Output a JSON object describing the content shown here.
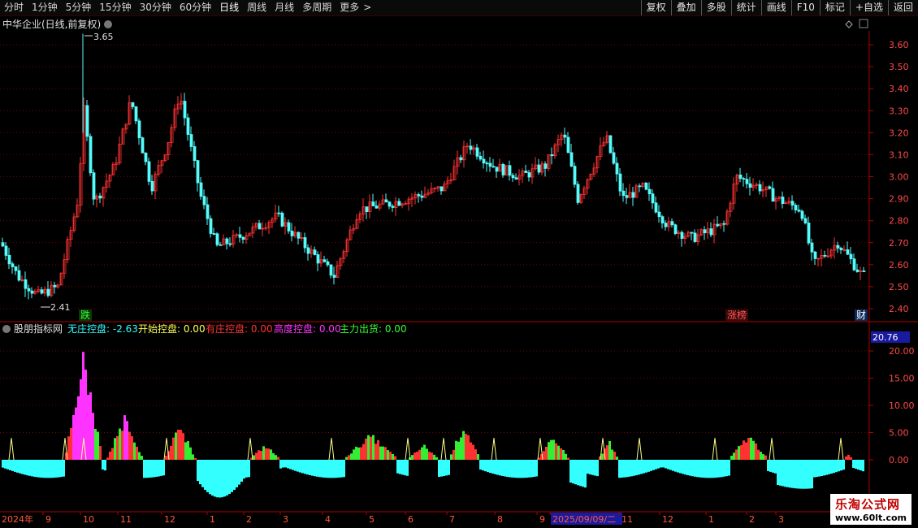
{
  "toolbar": {
    "periods": [
      "分时",
      "1分钟",
      "5分钟",
      "15分钟",
      "30分钟",
      "60分钟",
      "日线",
      "周线",
      "月线",
      "多周期",
      "更多"
    ],
    "more_arrow": ">",
    "active_period": "日线",
    "actions": [
      "复权",
      "叠加",
      "多股",
      "统计",
      "画线",
      "F10",
      "标记",
      "+自选",
      "返回"
    ]
  },
  "main_panel": {
    "title": "中华企业(日线,前复权)",
    "high_label": "3.65",
    "low_label": "2.41",
    "y_ticks": [
      "3.60",
      "3.50",
      "3.40",
      "3.30",
      "3.20",
      "3.10",
      "3.00",
      "2.90",
      "2.80",
      "2.70",
      "2.60",
      "2.50",
      "2.40"
    ],
    "markers": [
      "跌",
      "涨榜",
      "财"
    ]
  },
  "indicator_panel": {
    "name": "股朋指标网",
    "legend": [
      {
        "label": "无庄控盘:",
        "value": "-2.63",
        "color": "#33ffff"
      },
      {
        "label": "开始控盘:",
        "value": "0.00",
        "color": "#ffff55"
      },
      {
        "label": "有庄控盘:",
        "value": "0.00",
        "color": "#ff3333"
      },
      {
        "label": "高度控盘:",
        "value": "0.00",
        "color": "#ff33ff"
      },
      {
        "label": "主力出货:",
        "value": "0.00",
        "color": "#33ff33"
      }
    ],
    "value_box": "20.76",
    "y_ticks": [
      "20.00",
      "15.00",
      "10.00",
      "5.00",
      "0.00"
    ]
  },
  "date_axis": {
    "labels": [
      "2024年",
      "9",
      "10",
      "11",
      "12",
      "1",
      "2",
      "3",
      "4",
      "5",
      "6",
      "7",
      "8",
      "9",
      "2025/09/09/二",
      "11",
      "12",
      "1",
      "2",
      "3"
    ],
    "highlight": "2025/09/09/二"
  },
  "watermark": {
    "line1": "乐淘公式网",
    "line2": "www.60lt.com"
  },
  "colors": {
    "up": "#ff3232",
    "down": "#54fcfc",
    "grid": "#7a0000",
    "axis": "#b00000"
  }
}
